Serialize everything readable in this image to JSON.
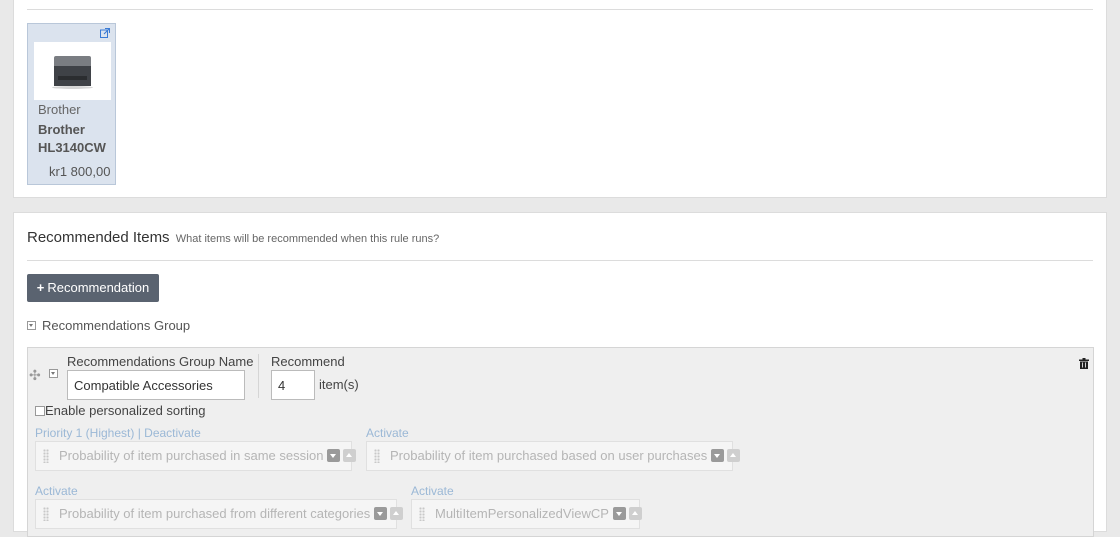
{
  "product": {
    "brand": "Brother",
    "name": "Brother HL3140CW",
    "price": "kr1 800,00"
  },
  "recommended": {
    "title": "Recommended Items",
    "subtitle": "What items will be recommended when this rule runs?",
    "add_button": "Recommendation",
    "group_toggle_label": "Recommendations Group"
  },
  "group": {
    "name_label": "Recommendations Group Name",
    "name_value": "Compatible Accessories",
    "recommend_label": "Recommend",
    "recommend_value": "4",
    "items_suffix": "item(s)",
    "personalized_label": "Enable personalized sorting",
    "slots": [
      {
        "priority": "Priority 1 (Highest)",
        "action": "Deactivate",
        "strategy": "Probability of item purchased in same session"
      },
      {
        "priority": "",
        "action": "Activate",
        "strategy": "Probability of item purchased based on user purchases"
      },
      {
        "priority": "",
        "action": "Activate",
        "strategy": "Probability of item purchased from different categories"
      },
      {
        "priority": "",
        "action": "Activate",
        "strategy": "MultiItemPersonalizedViewCP"
      }
    ]
  },
  "colors": {
    "button_bg": "#5a6370",
    "card_bg": "#dbe3ee",
    "link_muted": "#9bb8d6"
  },
  "icons": [
    "external-link-icon",
    "plus-icon",
    "collapse-icon",
    "drag-handle-icon",
    "trash-icon",
    "grip-icon",
    "move-down-icon",
    "move-up-icon"
  ]
}
